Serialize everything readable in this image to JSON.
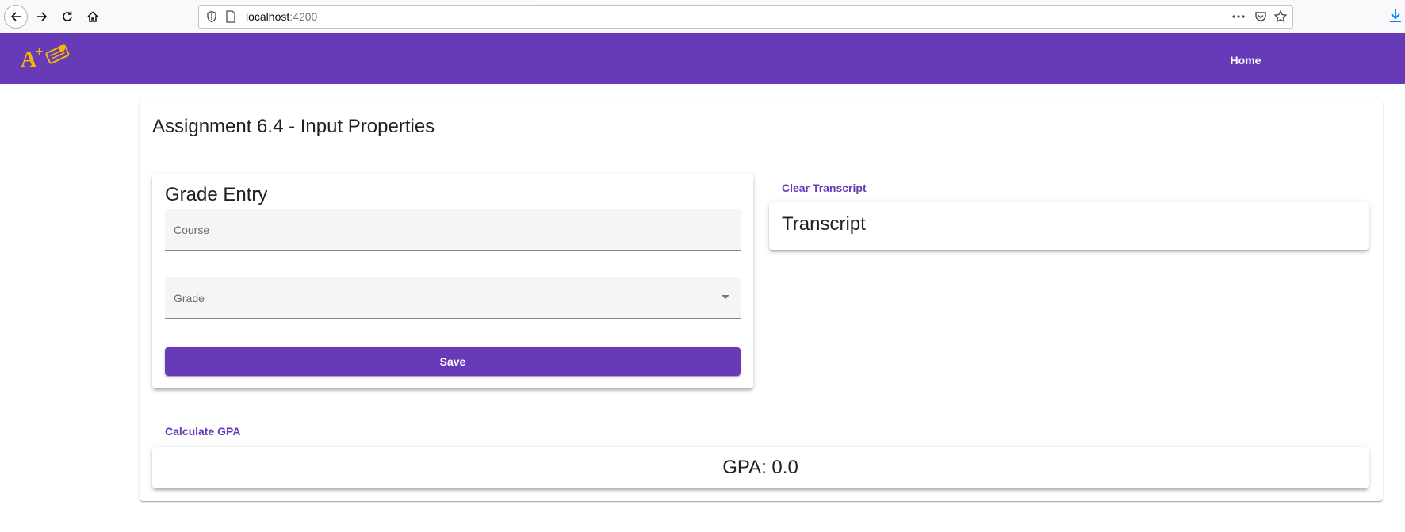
{
  "browser": {
    "url_host": "localhost",
    "url_port": ":4200",
    "icons": {
      "back": "back-arrow-icon",
      "forward": "forward-arrow-icon",
      "reload": "reload-icon",
      "home": "home-icon",
      "shield": "tracking-shield-icon",
      "page": "page-icon",
      "more": "more-dots-icon",
      "pocket": "pocket-icon",
      "bookmark": "star-icon",
      "download": "download-icon"
    }
  },
  "toolbar": {
    "logo": "A+ logo",
    "home_label": "Home",
    "color": "#673ab7"
  },
  "main": {
    "title": "Assignment 6.4 - Input Properties",
    "grade_entry": {
      "title": "Grade Entry",
      "course_label": "Course",
      "course_value": "",
      "grade_label": "Grade",
      "grade_value": "",
      "save_label": "Save"
    },
    "transcript": {
      "clear_label": "Clear Transcript",
      "title": "Transcript"
    },
    "gpa": {
      "calculate_label": "Calculate GPA",
      "text": "GPA: 0.0"
    }
  }
}
